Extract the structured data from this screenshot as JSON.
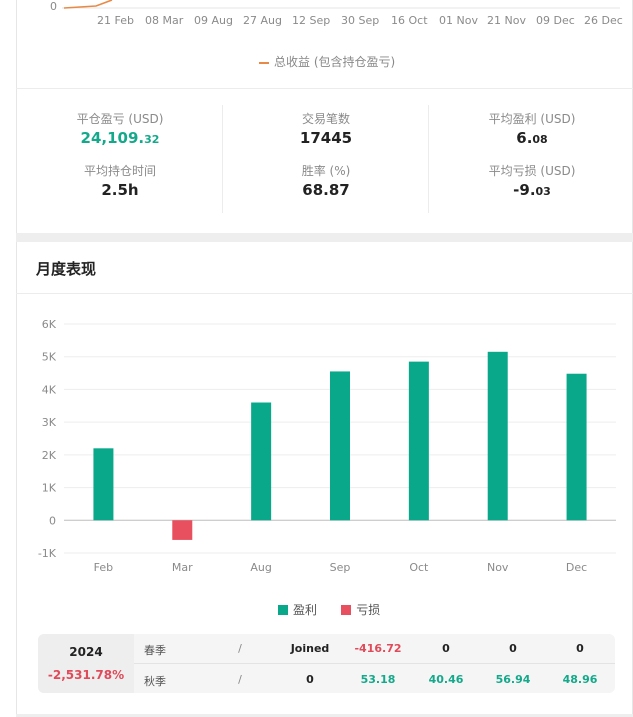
{
  "top_chart": {
    "y_zero_label": "0",
    "x_labels": [
      "21 Feb",
      "08 Mar",
      "09 Aug",
      "27 Aug",
      "12 Sep",
      "30 Sep",
      "16 Oct",
      "01 Nov",
      "21 Nov",
      "09 Dec",
      "26 Dec"
    ],
    "legend": "总收益 (包含持仓盈亏)",
    "line_color": "#e88a45"
  },
  "stats": {
    "closed_pnl_label": "平仓盈亏 (USD)",
    "closed_pnl_int": "24,109.",
    "closed_pnl_dec": "32",
    "trades_label": "交易笔数",
    "trades_value": "17445",
    "avg_profit_label": "平均盈利 (USD)",
    "avg_profit_int": "6.",
    "avg_profit_dec": "08",
    "avg_hold_label": "平均持仓时间",
    "avg_hold_value": "2.5h",
    "win_rate_label": "胜率 (%)",
    "win_rate_value": "68.87",
    "avg_loss_label": "平均亏损 (USD)",
    "avg_loss_int": "-9.",
    "avg_loss_dec": "03"
  },
  "monthly": {
    "title": "月度表现",
    "legend_profit": "盈利",
    "legend_loss": "亏损",
    "profit_color": "#0aa88a",
    "loss_color": "#e8505f"
  },
  "chart_data": {
    "type": "bar",
    "categories": [
      "Feb",
      "Mar",
      "Aug",
      "Sep",
      "Oct",
      "Nov",
      "Dec"
    ],
    "values": [
      2200,
      -600,
      3600,
      4550,
      4850,
      5150,
      4480
    ],
    "ylim": [
      -1000,
      6000
    ],
    "yticks": [
      "6K",
      "5K",
      "4K",
      "3K",
      "2K",
      "1K",
      "0",
      "-1K"
    ],
    "grid": true,
    "legend_position": "bottom"
  },
  "table": {
    "year": "2024",
    "year_return": "-2,531.78%",
    "rows": [
      {
        "label": "春季",
        "sep": "/",
        "c1": "Joined",
        "c2": "-416.72",
        "c3": "0",
        "c4": "0",
        "c5": "0"
      },
      {
        "label": "秋季",
        "sep": "/",
        "c1": "0",
        "c2": "53.18",
        "c3": "40.46",
        "c4": "56.94",
        "c5": "48.96"
      }
    ]
  }
}
